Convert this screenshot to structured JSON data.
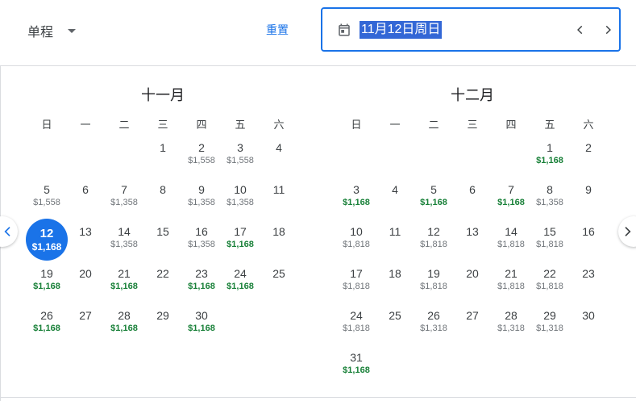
{
  "header": {
    "trip_type": "单程",
    "reset_label": "重置",
    "date_value": "11月12日周日"
  },
  "colors": {
    "accent": "#1a73e8",
    "low_price": "#188038",
    "text": "#3c4043"
  },
  "icons": [
    "calendar-icon",
    "chevron-left-icon",
    "chevron-right-icon",
    "caret-down-icon"
  ],
  "weekdays": [
    "日",
    "一",
    "二",
    "三",
    "四",
    "五",
    "六"
  ],
  "months": [
    {
      "title": "十一月",
      "offset": 3,
      "days": [
        {
          "d": "1",
          "p": ""
        },
        {
          "d": "2",
          "p": "$1,558"
        },
        {
          "d": "3",
          "p": "$1,558"
        },
        {
          "d": "4",
          "p": ""
        },
        {
          "d": "5",
          "p": "$1,558"
        },
        {
          "d": "6",
          "p": ""
        },
        {
          "d": "7",
          "p": "$1,358"
        },
        {
          "d": "8",
          "p": ""
        },
        {
          "d": "9",
          "p": "$1,358"
        },
        {
          "d": "10",
          "p": "$1,358"
        },
        {
          "d": "11",
          "p": ""
        },
        {
          "d": "12",
          "p": "$1,168",
          "low": true,
          "selected": true
        },
        {
          "d": "13",
          "p": ""
        },
        {
          "d": "14",
          "p": "$1,358"
        },
        {
          "d": "15",
          "p": ""
        },
        {
          "d": "16",
          "p": "$1,358"
        },
        {
          "d": "17",
          "p": "$1,168",
          "low": true
        },
        {
          "d": "18",
          "p": ""
        },
        {
          "d": "19",
          "p": "$1,168",
          "low": true
        },
        {
          "d": "20",
          "p": ""
        },
        {
          "d": "21",
          "p": "$1,168",
          "low": true
        },
        {
          "d": "22",
          "p": ""
        },
        {
          "d": "23",
          "p": "$1,168",
          "low": true
        },
        {
          "d": "24",
          "p": "$1,168",
          "low": true
        },
        {
          "d": "25",
          "p": ""
        },
        {
          "d": "26",
          "p": "$1,168",
          "low": true
        },
        {
          "d": "27",
          "p": ""
        },
        {
          "d": "28",
          "p": "$1,168",
          "low": true
        },
        {
          "d": "29",
          "p": ""
        },
        {
          "d": "30",
          "p": "$1,168",
          "low": true
        }
      ]
    },
    {
      "title": "十二月",
      "offset": 5,
      "days": [
        {
          "d": "1",
          "p": "$1,168",
          "low": true
        },
        {
          "d": "2",
          "p": ""
        },
        {
          "d": "3",
          "p": "$1,168",
          "low": true
        },
        {
          "d": "4",
          "p": ""
        },
        {
          "d": "5",
          "p": "$1,168",
          "low": true
        },
        {
          "d": "6",
          "p": ""
        },
        {
          "d": "7",
          "p": "$1,168",
          "low": true
        },
        {
          "d": "8",
          "p": "$1,358"
        },
        {
          "d": "9",
          "p": ""
        },
        {
          "d": "10",
          "p": "$1,818"
        },
        {
          "d": "11",
          "p": ""
        },
        {
          "d": "12",
          "p": "$1,818"
        },
        {
          "d": "13",
          "p": ""
        },
        {
          "d": "14",
          "p": "$1,818"
        },
        {
          "d": "15",
          "p": "$1,818"
        },
        {
          "d": "16",
          "p": ""
        },
        {
          "d": "17",
          "p": "$1,818"
        },
        {
          "d": "18",
          "p": ""
        },
        {
          "d": "19",
          "p": "$1,818"
        },
        {
          "d": "20",
          "p": ""
        },
        {
          "d": "21",
          "p": "$1,818"
        },
        {
          "d": "22",
          "p": "$1,818"
        },
        {
          "d": "23",
          "p": ""
        },
        {
          "d": "24",
          "p": "$1,818"
        },
        {
          "d": "25",
          "p": ""
        },
        {
          "d": "26",
          "p": "$1,318"
        },
        {
          "d": "27",
          "p": ""
        },
        {
          "d": "28",
          "p": "$1,318"
        },
        {
          "d": "29",
          "p": "$1,318"
        },
        {
          "d": "30",
          "p": ""
        },
        {
          "d": "31",
          "p": "$1,168",
          "low": true
        }
      ]
    }
  ]
}
